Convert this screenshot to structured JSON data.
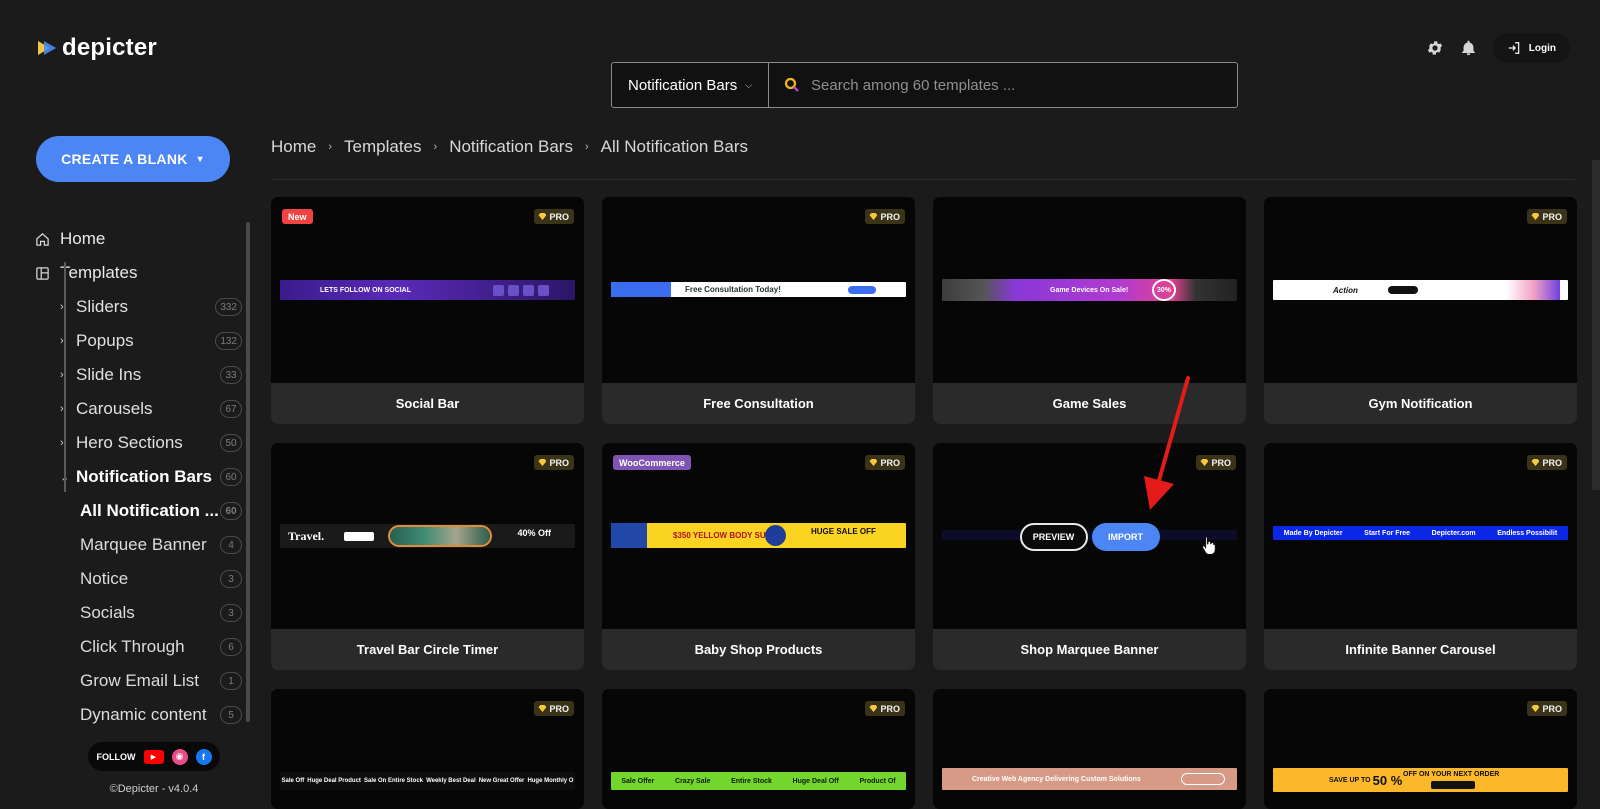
{
  "brand": {
    "name": "depicter"
  },
  "header": {
    "login_label": "Login",
    "settings_icon": "gear-icon",
    "bell_icon": "bell-icon"
  },
  "search": {
    "category": "Notification Bars",
    "placeholder": "Search among 60 templates ..."
  },
  "create_button": {
    "label": "CREATE A BLANK"
  },
  "sidebar": {
    "top": [
      {
        "label": "Home",
        "icon": "home-icon"
      },
      {
        "label": "Templates",
        "icon": "templates-icon"
      }
    ],
    "categories": [
      {
        "label": "Sliders",
        "count": "332"
      },
      {
        "label": "Popups",
        "count": "132"
      },
      {
        "label": "Slide Ins",
        "count": "33"
      },
      {
        "label": "Carousels",
        "count": "67"
      },
      {
        "label": "Hero Sections",
        "count": "50"
      },
      {
        "label": "Notification Bars",
        "count": "60"
      }
    ],
    "subcategories": [
      {
        "label": "All Notification ...",
        "count": "60"
      },
      {
        "label": "Marquee Banner",
        "count": "4"
      },
      {
        "label": "Notice",
        "count": "3"
      },
      {
        "label": "Socials",
        "count": "3"
      },
      {
        "label": "Click Through",
        "count": "6"
      },
      {
        "label": "Grow Email List",
        "count": "1"
      },
      {
        "label": "Dynamic content",
        "count": "5"
      }
    ],
    "follow_label": "FOLLOW",
    "copyright": "©Depicter - v4.0.4"
  },
  "breadcrumb": [
    "Home",
    "Templates",
    "Notification Bars",
    "All Notification Bars"
  ],
  "badges": {
    "pro": "PRO",
    "new": "New",
    "woo": "WooCommerce"
  },
  "overlay": {
    "preview": "PREVIEW",
    "import": "IMPORT"
  },
  "cards": [
    {
      "title": "Social Bar",
      "strip_text": "LETS FOLLOW ON SOCIAL"
    },
    {
      "title": "Free Consultation",
      "strip_text": "Free Consultation Today!"
    },
    {
      "title": "Game Sales",
      "strip_text": "Game Devices On Sale!",
      "strip_extra": "30%"
    },
    {
      "title": "Gym Notification",
      "strip_text": "Action"
    },
    {
      "title": "Travel Bar Circle Timer",
      "strip_text": "Travel.",
      "strip_extra": "40% Off"
    },
    {
      "title": "Baby Shop Products",
      "strip_text": "$350 YELLOW BODY SUIT",
      "strip_extra": "HUGE SALE OFF"
    },
    {
      "title": "Shop Marquee Banner"
    },
    {
      "title": "Infinite Banner Carousel",
      "strip_items": [
        "Made By Depicter",
        "Start For Free",
        "Depicter.com",
        "Endless Possibilit"
      ]
    },
    {
      "strip_items": [
        "Sale Off",
        "Huge Deal Product",
        "Sale On Entire Stock",
        "Weekly Best Deal",
        "New Great Offer",
        "Huge Monthly O"
      ]
    },
    {
      "strip_items": [
        "Sale Offer",
        "Crazy Sale",
        "Entire Stock",
        "Huge Deal Off",
        "Product Of"
      ]
    },
    {
      "strip_text": "Creative Web Agency Delivering Custom Solutions"
    },
    {
      "strip_text": "SAVE UP TO",
      "strip_extra": "50 %",
      "strip_sub": "OFF ON YOUR NEXT ORDER"
    }
  ]
}
